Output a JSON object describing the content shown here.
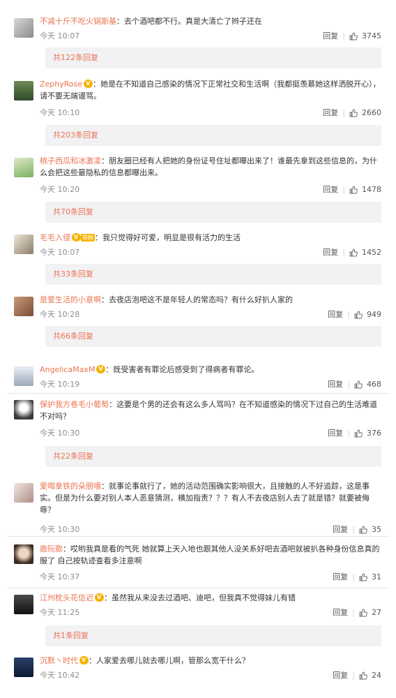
{
  "comments": [
    {
      "user": "不减十斤不吃火锅斯基",
      "text": "：去个酒吧都不行。真是大清亡了辫子还在",
      "time": "今天 10:07",
      "reply": "回复",
      "likes": "3745",
      "thread": "共122条回复"
    },
    {
      "user": "ZephyRose",
      "text": "：她是在不知道自己感染的情况下正常社交和生活啊（我都挺羡慕她这样洒脱开心），请不要无端谩骂。",
      "time": "今天 10:10",
      "reply": "回复",
      "likes": "2660",
      "thread": "共203条回复"
    },
    {
      "user": "桃子西瓜和冰激凌",
      "text": "：朋友圈已经有人把她的身份证号住址都曝出来了！谁最先拿到这些信息的，为什么会把这些最隐私的信息都曝出来。",
      "time": "今天 10:20",
      "reply": "回复",
      "likes": "1478",
      "thread": "共70条回复"
    },
    {
      "user": "毛毛入侵",
      "tag": "铁粉",
      "text": "：我只觉得好可爱，明显是很有活力的生活",
      "time": "今天 10:07",
      "reply": "回复",
      "likes": "1452",
      "thread": "共33条回复"
    },
    {
      "user": "是爱生活的小意啊",
      "text": "：去夜店泡吧这不是年轻人的常态吗？有什么好扒人家的",
      "time": "今天 10:28",
      "reply": "回复",
      "likes": "949",
      "thread": "共66条回复"
    },
    {
      "user": "AngelicaMaxM",
      "text": "：既受害者有罪论后感受到了得病者有罪论。",
      "time": "今天 10:19",
      "reply": "回复",
      "likes": "468"
    },
    {
      "user": "保护我方卷毛小葡萄",
      "text": "：这要是个男的还会有这么多人骂吗？在不知道感染的情况下过自己的生活难道不对吗？",
      "time": "今天 10:30",
      "reply": "回复",
      "likes": "376",
      "thread": "共22条回复"
    },
    {
      "user": "爱喝拿铁的朵朋嘻",
      "text": "：就事论事就行了，她的活动范围确实影响很大，且接触的人不好追踪，这是事实。但是为什么要对别人本人恶意猜测，横加指责？？？有人不去夜店别人去了就是错？就要被侮辱？",
      "time": "今天 10:30",
      "reply": "回复",
      "likes": "35"
    },
    {
      "user": "鹿阮歌",
      "text": "：哎哟我真是看的气死 她就算上天入地也跟其他人没关系好吧去酒吧就被扒各种身份信息真的服了 自己按轨迹查看多注意啊",
      "time": "今天 10:37",
      "reply": "回复",
      "likes": "31"
    },
    {
      "user": "江州枕头花信迟",
      "text": "：虽然我从来没去过酒吧、迪吧，但我真不觉得妹儿有错",
      "time": "今天 11:25",
      "reply": "回复",
      "likes": "27",
      "thread": "共1条回复"
    },
    {
      "user": "沉默丶时代",
      "text": "：人家爱去哪儿就去哪儿啊，管那么宽干什么？",
      "time": "今天 10:42",
      "reply": "回复",
      "likes": "24"
    }
  ],
  "colors": {
    "username": "#eb7350",
    "background": "#f2f2f5",
    "badge": "#f6b400"
  }
}
